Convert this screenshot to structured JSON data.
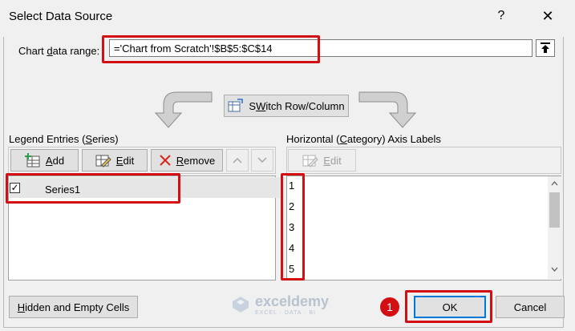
{
  "window": {
    "title": "Select Data Source",
    "help": "?",
    "close": "✕"
  },
  "range": {
    "label_pre": "Chart ",
    "label_underline": "d",
    "label_post": "ata range:",
    "value": "='Chart from Scratch'!$B$5:$C$14"
  },
  "switch_button": {
    "label_underline": "W",
    "label_pre": "S",
    "label_post": "itch Row/Column"
  },
  "legend": {
    "label_pre": "Legend Entries (",
    "label_underline": "S",
    "label_post": "eries)",
    "add_underline": "A",
    "add_post": "dd",
    "edit_underline": "E",
    "edit_post": "dit",
    "remove_underline": "R",
    "remove_post": "emove",
    "series": [
      {
        "name": "Series1",
        "checked": true
      }
    ]
  },
  "category": {
    "label_pre": "Horizontal (",
    "label_underline": "C",
    "label_post": "ategory) Axis Labels",
    "edit_underline": "E",
    "edit_post": "dit",
    "items": [
      "1",
      "2",
      "3",
      "4",
      "5"
    ]
  },
  "footer": {
    "hidden_underline": "H",
    "hidden_post": "idden and Empty Cells",
    "ok": "OK",
    "cancel": "Cancel",
    "badge": "1"
  },
  "watermark": {
    "name": "exceldemy",
    "tagline": "EXCEL · DATA · BI"
  },
  "colors": {
    "highlight_red": "#d40f14",
    "remove_red": "#d9251e",
    "ok_border": "#0078d7"
  }
}
